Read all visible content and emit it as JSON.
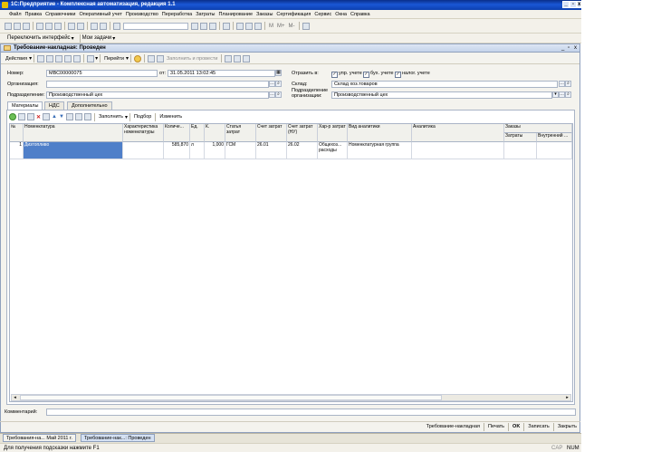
{
  "app": {
    "title": "1С:Предприятие - Комплексная автоматизация, редакция 1.1"
  },
  "menu": [
    "Файл",
    "Правка",
    "Справочники",
    "Оперативный учет",
    "Производство",
    "Переработка",
    "Затраты",
    "Планирование",
    "Заказы",
    "Сертификация",
    "Сервис",
    "Окна",
    "Справка"
  ],
  "toolbar1": {
    "mem_labels": [
      "M",
      "M+",
      "M-"
    ]
  },
  "panelbar": {
    "switch_interface": "Переключить интерфейс",
    "my_tasks": "Мои задачи"
  },
  "document": {
    "title": "Требование-накладная: Проведен",
    "toolbar": {
      "actions": "Действия",
      "goto": "Перейти",
      "fill_and_post": "Заполнить и провести"
    },
    "fields": {
      "number_label": "Номер:",
      "number_value": "МВС00000075",
      "date_label": "от:",
      "date_value": "31.05.2011 13:02:45",
      "org_label": "Организация:",
      "org_value": "",
      "dept_label": "Подразделение:",
      "dept_value": "Производственный цех",
      "reflect_label": "Отразить в:",
      "reflect_options": [
        "упр. учете",
        "бух. учете",
        "налог. учете"
      ],
      "warehouse_label": "Склад:",
      "warehouse_value": "Склад хоз.товаров",
      "org_dept_label_1": "Подразделение",
      "org_dept_label_2": "организации:",
      "org_dept_value": "Производственный цех"
    },
    "tabs": [
      "Материалы",
      "НДС",
      "Дополнительно"
    ],
    "table_toolbar": {
      "fill": "Заполнить",
      "pick": "Подбор",
      "change": "Изменить"
    },
    "columns": [
      "№",
      "Номенклатура",
      "Характеристика номенклатуры",
      "Количе...",
      "Ед.",
      "К.",
      "Статья затрат",
      "Счет затрат",
      "Счет затрат (НУ)",
      "Хар-р затрат",
      "Вид аналитики",
      "Аналитика",
      "Заказы"
    ],
    "orders_subcolumns": [
      "Затраты",
      "Внутренний ..."
    ],
    "rows": [
      {
        "n": "1",
        "nomenclature": "Дизтопливо",
        "characteristic": "",
        "qty": "585,870",
        "unit": "л",
        "k": "1,000",
        "cost_item": "ГСМ",
        "account": "26.01",
        "account_nu": "26.02",
        "cost_kind": "Общехоз... расходы",
        "analytics_kind": "Номенклатурная группа",
        "analytics": "",
        "orders_costs": "",
        "orders_internal": ""
      }
    ],
    "comment_label": "Комментарий:",
    "comment_value": "",
    "bottom_buttons": [
      "Требование-накладная",
      "Печать",
      "OK",
      "Записать",
      "Закрыть"
    ]
  },
  "taskbar": [
    "Требования-на... Май 2011 г.",
    "Требование-нак...: Проведен"
  ],
  "status": {
    "hint": "Для получения подсказки нажмите F1",
    "cap": "CAP",
    "num": "NUM"
  }
}
